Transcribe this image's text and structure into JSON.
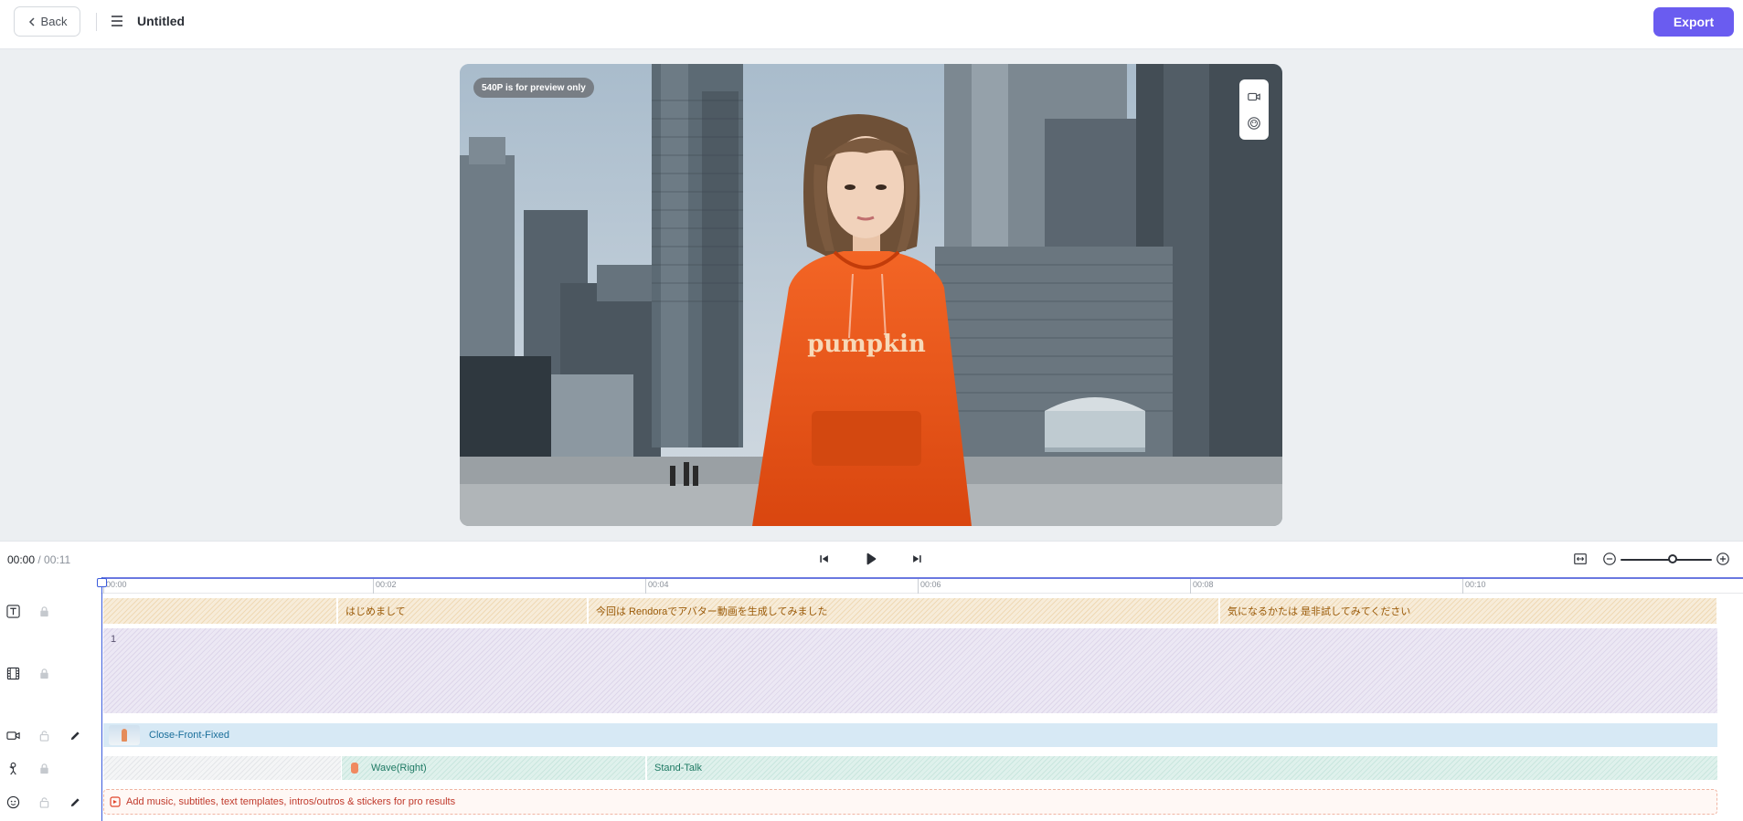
{
  "header": {
    "back_label": "Back",
    "title": "Untitled",
    "export_label": "Export"
  },
  "preview": {
    "badge": "540P is for preview only",
    "hoodie_text": "pumpkin"
  },
  "transport": {
    "current_time": "00:00",
    "total_time": " / 00:11"
  },
  "timeline": {
    "ticks": [
      "00:00",
      "00:02",
      "00:04",
      "00:06",
      "00:08",
      "00:10"
    ],
    "subtitles": [
      "",
      "はじめまして",
      "今回は Rendoraでアバター動画を生成してみました",
      "気になるかたは 是非試してみてください"
    ],
    "scene_label": "1",
    "camera_clip": "Close-Front-Fixed",
    "actions": [
      "Wave(Right)",
      "Stand-Talk"
    ],
    "tip": "Add music, subtitles, text templates, intros/outros & stickers for pro results"
  },
  "colors": {
    "accent": "#6a5cf0",
    "playhead": "#3b5bdb",
    "hoodie": "#f0541c"
  }
}
